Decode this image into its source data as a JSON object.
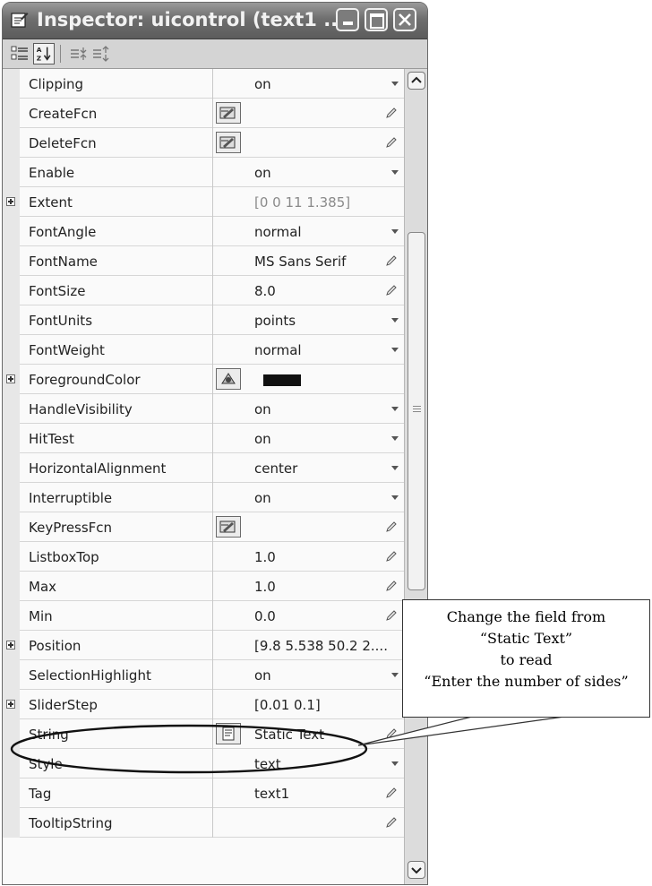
{
  "window": {
    "title": "Inspector:  uicontrol (text1 ...",
    "colors": {
      "titlebar": "#6e6e6e",
      "grid_background": "#fafafa",
      "swatch": "#111111"
    }
  },
  "toolbar": {
    "buttons": [
      "categorized-view-icon",
      "alphabetical-sort-icon",
      "expand-all-icon",
      "collapse-all-icon"
    ]
  },
  "properties": [
    {
      "name": "Clipping",
      "value": "on",
      "widget": "dropdown"
    },
    {
      "name": "CreateFcn",
      "value": "",
      "widget": "edit",
      "button": "callback-editor-icon"
    },
    {
      "name": "DeleteFcn",
      "value": "",
      "widget": "edit",
      "button": "callback-editor-icon"
    },
    {
      "name": "Enable",
      "value": "on",
      "widget": "dropdown"
    },
    {
      "name": "Extent",
      "value": "[0 0 11 1.385]",
      "widget": "readonly",
      "expandable": true
    },
    {
      "name": "FontAngle",
      "value": "normal",
      "widget": "dropdown"
    },
    {
      "name": "FontName",
      "value": "MS Sans Serif",
      "widget": "edit"
    },
    {
      "name": "FontSize",
      "value": "8.0",
      "widget": "edit"
    },
    {
      "name": "FontUnits",
      "value": "points",
      "widget": "dropdown"
    },
    {
      "name": "FontWeight",
      "value": "normal",
      "widget": "dropdown"
    },
    {
      "name": "ForegroundColor",
      "value": "",
      "widget": "color",
      "button": "color-picker-icon",
      "expandable": true
    },
    {
      "name": "HandleVisibility",
      "value": "on",
      "widget": "dropdown"
    },
    {
      "name": "HitTest",
      "value": "on",
      "widget": "dropdown"
    },
    {
      "name": "HorizontalAlignment",
      "value": "center",
      "widget": "dropdown"
    },
    {
      "name": "Interruptible",
      "value": "on",
      "widget": "dropdown"
    },
    {
      "name": "KeyPressFcn",
      "value": "",
      "widget": "edit",
      "button": "callback-editor-icon"
    },
    {
      "name": "ListboxTop",
      "value": "1.0",
      "widget": "edit"
    },
    {
      "name": "Max",
      "value": "1.0",
      "widget": "edit"
    },
    {
      "name": "Min",
      "value": "0.0",
      "widget": "edit"
    },
    {
      "name": "Position",
      "value": "[9.8 5.538 50.2 2....",
      "widget": "none",
      "expandable": true
    },
    {
      "name": "SelectionHighlight",
      "value": "on",
      "widget": "dropdown"
    },
    {
      "name": "SliderStep",
      "value": "[0.01 0.1]",
      "widget": "none",
      "expandable": true
    },
    {
      "name": "String",
      "value": "Static Text",
      "widget": "edit",
      "button": "string-editor-icon"
    },
    {
      "name": "Style",
      "value": "text",
      "widget": "dropdown"
    },
    {
      "name": "Tag",
      "value": "text1",
      "widget": "edit"
    },
    {
      "name": "TooltipString",
      "value": "",
      "widget": "edit"
    }
  ],
  "callout": {
    "lines": [
      "Change the field from",
      "“Static Text”",
      "to read",
      "“Enter the number of sides”"
    ]
  }
}
